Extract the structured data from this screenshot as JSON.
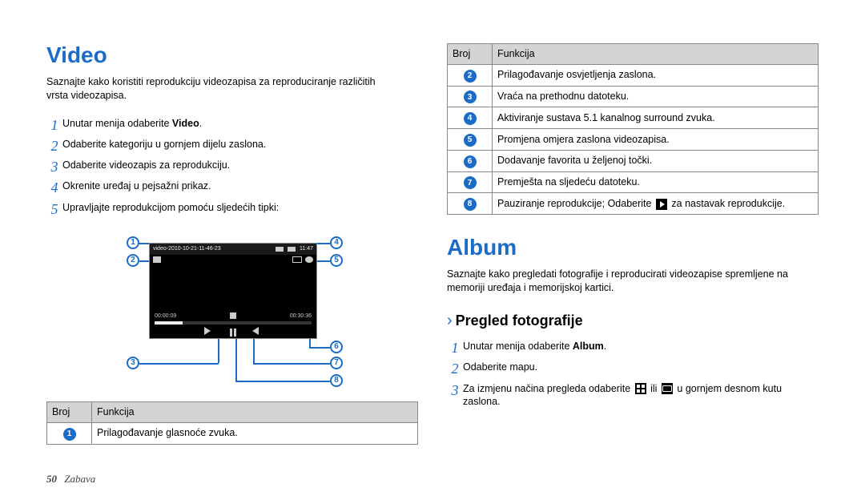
{
  "left": {
    "heading": "Video",
    "intro": "Saznajte kako koristiti reprodukciju videozapisa za reproduciranje različitih vrsta videozapisa.",
    "steps": [
      {
        "pre": "Unutar menija odaberite ",
        "bold": "Video",
        "post": "."
      },
      {
        "pre": "Odaberite kategoriju u gornjem dijelu zaslona."
      },
      {
        "pre": "Odaberite videozapis za reprodukciju."
      },
      {
        "pre": "Okrenite uređaj u pejsažni prikaz."
      },
      {
        "pre": "Upravljajte reprodukcijom pomoću sljedećih tipki:"
      }
    ],
    "player": {
      "title": "video-2010-10-21-11-46-23",
      "clock": "11:47",
      "time_cur": "00:00:09",
      "time_end": "00:30:36"
    },
    "table": {
      "h1": "Broj",
      "h2": "Funkcija",
      "rows": [
        {
          "n": "1",
          "t": "Prilagođavanje glasnoće zvuka."
        }
      ]
    }
  },
  "right": {
    "table": {
      "h1": "Broj",
      "h2": "Funkcija",
      "rows": [
        {
          "n": "2",
          "t": "Prilagođavanje osvjetljenja zaslona."
        },
        {
          "n": "3",
          "t": "Vraća na prethodnu datoteku."
        },
        {
          "n": "4",
          "t": "Aktiviranje sustava 5.1 kanalnog surround zvuka."
        },
        {
          "n": "5",
          "t": "Promjena omjera zaslona videozapisa."
        },
        {
          "n": "6",
          "t": "Dodavanje favorita u željenoj točki."
        },
        {
          "n": "7",
          "t": "Premješta na sljedeću datoteku."
        },
        {
          "n": "8",
          "t_pre": "Pauziranje reprodukcije; Odaberite ",
          "t_post": " za nastavak reprodukcije."
        }
      ]
    },
    "album_heading": "Album",
    "album_intro": "Saznajte kako pregledati fotografije i reproducirati videozapise spremljene na memoriji uređaja i memorijskoj kartici.",
    "sub_heading": "Pregled fotografije",
    "steps": [
      {
        "pre": "Unutar menija odaberite ",
        "bold": "Album",
        "post": "."
      },
      {
        "pre": "Odaberite mapu."
      },
      {
        "pre": "Za izmjenu načina pregleda odaberite ",
        "ic1": true,
        "mid": " ili ",
        "ic2": true,
        "post": " u gornjem desnom kutu zaslona."
      }
    ]
  },
  "callouts": [
    "1",
    "2",
    "3",
    "4",
    "5",
    "6",
    "7",
    "8"
  ],
  "footer": {
    "page": "50",
    "section": "Zabava"
  }
}
